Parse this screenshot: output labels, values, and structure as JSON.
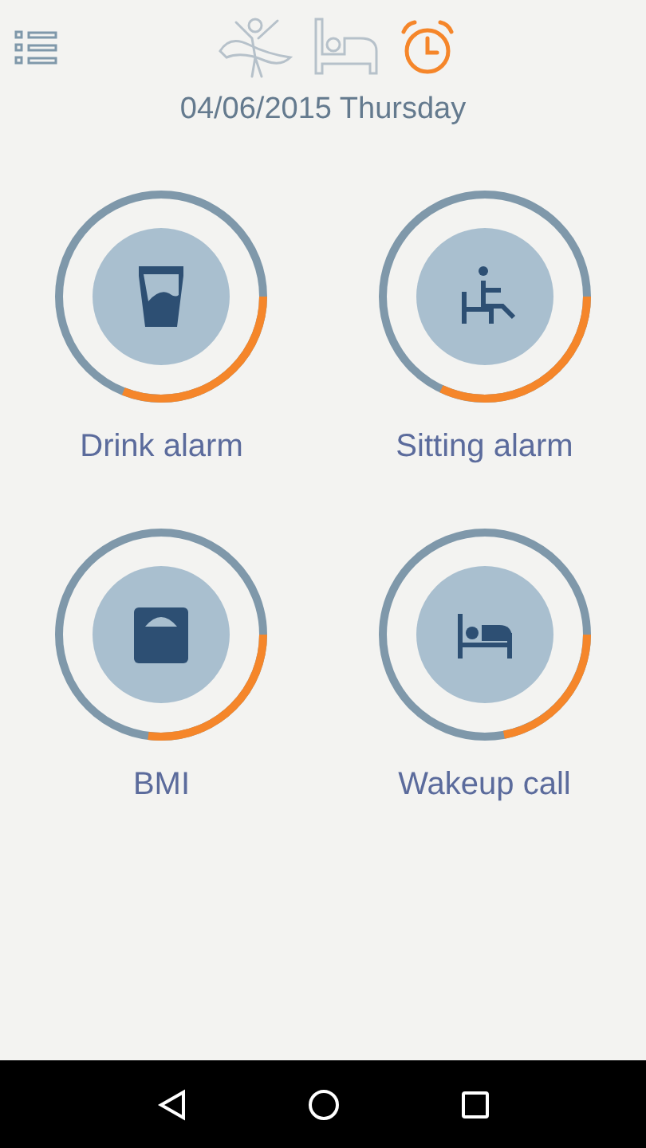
{
  "tabs": [
    {
      "kind": "exercise",
      "selected": false
    },
    {
      "kind": "sleep",
      "selected": false
    },
    {
      "kind": "alarm",
      "selected": true
    }
  ],
  "date": "04/06/2015 Thursday",
  "tiles": [
    {
      "kind": "drink",
      "label": "Drink alarm",
      "level": 0.31
    },
    {
      "kind": "sitting",
      "label": "Sitting alarm",
      "level": 0.32
    },
    {
      "kind": "scale",
      "label": "BMI",
      "level": 0.27
    },
    {
      "kind": "bed",
      "label": "Wakeup call",
      "level": 0.22
    }
  ]
}
